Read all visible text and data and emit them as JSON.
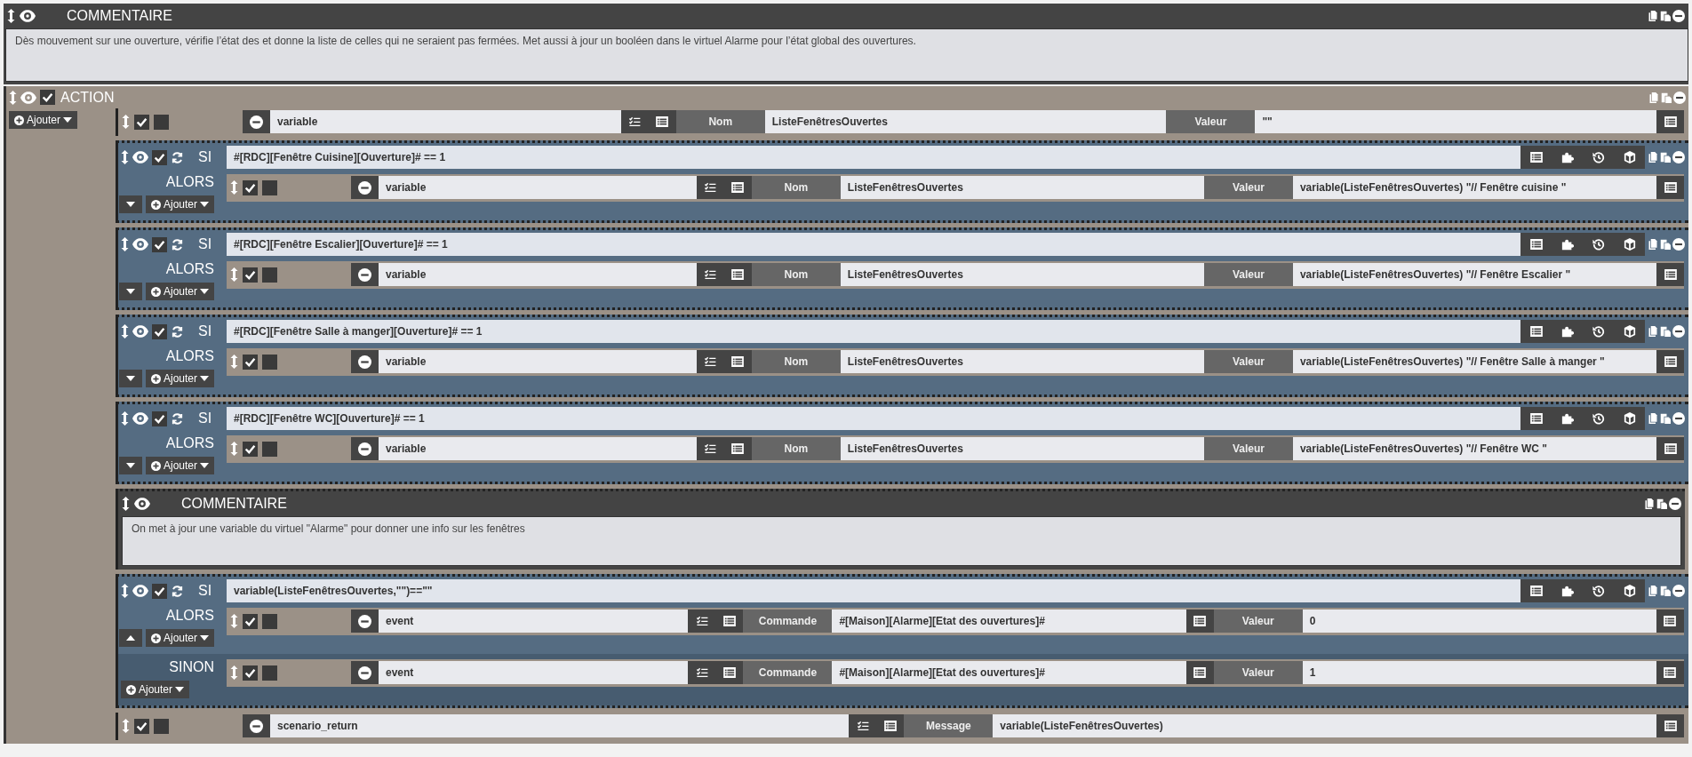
{
  "blocks": [
    {
      "kind": "comment",
      "title": "COMMENTAIRE",
      "text": "Dès mouvement sur une ouverture, vérifie l’état des et donne la liste de celles qui ne seraient pas fermées. Met aussi à jour un booléen dans le virtuel Alarme pour l’état global des ouvertures."
    },
    {
      "kind": "action",
      "title": "ACTION",
      "enabled": true,
      "add_label": "Ajouter",
      "items": [
        {
          "kind": "action",
          "enabled": true,
          "parallel": false,
          "command": "variable",
          "fields": [
            {
              "label": "Nom",
              "value": "ListeFenêtresOuvertes",
              "picker": false
            },
            {
              "label": "Valeur",
              "value": "\"\"",
              "picker": true
            }
          ]
        },
        {
          "kind": "if",
          "keyword": "SI",
          "enabled": true,
          "condition": "#[RDC][Fenêtre Cuisine][Ouverture]# == 1",
          "then_label": "ALORS",
          "add_label": "Ajouter",
          "else_open": false,
          "then": [
            {
              "kind": "action",
              "enabled": true,
              "parallel": false,
              "command": "variable",
              "fields": [
                {
                  "label": "Nom",
                  "value": "ListeFenêtresOuvertes",
                  "picker": false
                },
                {
                  "label": "Valeur",
                  "value": "variable(ListeFenêtresOuvertes) \"// Fenêtre cuisine \"",
                  "picker": true
                }
              ]
            }
          ]
        },
        {
          "kind": "if",
          "keyword": "SI",
          "enabled": true,
          "condition": "#[RDC][Fenêtre Escalier][Ouverture]# == 1",
          "then_label": "ALORS",
          "add_label": "Ajouter",
          "else_open": false,
          "then": [
            {
              "kind": "action",
              "enabled": true,
              "parallel": false,
              "command": "variable",
              "fields": [
                {
                  "label": "Nom",
                  "value": "ListeFenêtresOuvertes",
                  "picker": false
                },
                {
                  "label": "Valeur",
                  "value": "variable(ListeFenêtresOuvertes) \"// Fenêtre Escalier \"",
                  "picker": true
                }
              ]
            }
          ]
        },
        {
          "kind": "if",
          "keyword": "SI",
          "enabled": true,
          "condition": "#[RDC][Fenêtre Salle à manger][Ouverture]# == 1",
          "then_label": "ALORS",
          "add_label": "Ajouter",
          "else_open": false,
          "then": [
            {
              "kind": "action",
              "enabled": true,
              "parallel": false,
              "command": "variable",
              "fields": [
                {
                  "label": "Nom",
                  "value": "ListeFenêtresOuvertes",
                  "picker": false
                },
                {
                  "label": "Valeur",
                  "value": "variable(ListeFenêtresOuvertes) \"// Fenêtre Salle à manger \"",
                  "picker": true
                }
              ]
            }
          ]
        },
        {
          "kind": "if",
          "keyword": "SI",
          "enabled": true,
          "condition": "#[RDC][Fenêtre WC][Ouverture]# == 1",
          "then_label": "ALORS",
          "add_label": "Ajouter",
          "else_open": false,
          "then": [
            {
              "kind": "action",
              "enabled": true,
              "parallel": false,
              "command": "variable",
              "fields": [
                {
                  "label": "Nom",
                  "value": "ListeFenêtresOuvertes",
                  "picker": false
                },
                {
                  "label": "Valeur",
                  "value": "variable(ListeFenêtresOuvertes) \"// Fenêtre WC \"",
                  "picker": true
                }
              ]
            }
          ]
        },
        {
          "kind": "comment",
          "title": "COMMENTAIRE",
          "text": "On met à jour une variable du virtuel \"Alarme\" pour donner une info sur les fenêtres"
        },
        {
          "kind": "if",
          "keyword": "SI",
          "enabled": true,
          "condition": "variable(ListeFenêtresOuvertes,\"\")==\"\"",
          "then_label": "ALORS",
          "add_label": "Ajouter",
          "else_open": true,
          "else_label": "SINON",
          "else_add_label": "Ajouter",
          "then": [
            {
              "kind": "action",
              "enabled": true,
              "parallel": false,
              "command": "event",
              "fields": [
                {
                  "label": "Commande",
                  "value": "#[Maison][Alarme][Etat des ouvertures]#",
                  "picker": true
                },
                {
                  "label": "Valeur",
                  "value": "0",
                  "picker": true
                }
              ]
            }
          ],
          "else": [
            {
              "kind": "action",
              "enabled": true,
              "parallel": false,
              "command": "event",
              "fields": [
                {
                  "label": "Commande",
                  "value": "#[Maison][Alarme][Etat des ouvertures]#",
                  "picker": true
                },
                {
                  "label": "Valeur",
                  "value": "1",
                  "picker": true
                }
              ]
            }
          ]
        },
        {
          "kind": "action",
          "enabled": true,
          "parallel": false,
          "command": "scenario_return",
          "fields": [
            {
              "label": "Message",
              "value": "variable(ListeFenêtresOuvertes)",
              "picker": true
            }
          ]
        }
      ]
    }
  ]
}
